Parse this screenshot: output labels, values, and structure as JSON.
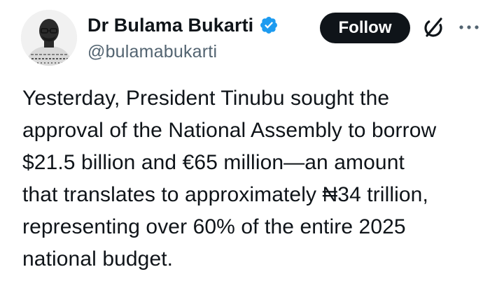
{
  "author": {
    "display_name": "Dr Bulama Bukarti",
    "handle": "@bulamabukarti",
    "verified": true,
    "verified_color": "#1d9bf0"
  },
  "actions": {
    "follow_label": "Follow",
    "grok_icon": "grok-icon",
    "more_icon": "more-horizontal-icon"
  },
  "tweet": {
    "text": "Yesterday, President Tinubu sought the\napproval of the National Assembly to borrow\n$21.5 billion and €65 million—an amount\nthat translates to approximately ₦34 trillion,\nrepresenting over 60% of the entire 2025\nnational budget."
  },
  "colors": {
    "text_primary": "#0f1419",
    "text_secondary": "#536471",
    "button_bg": "#0f1419",
    "button_text": "#ffffff"
  }
}
